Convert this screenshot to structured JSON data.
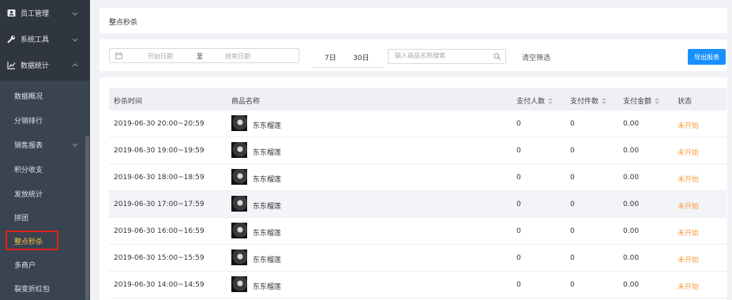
{
  "sidebar": {
    "top_items": [
      {
        "label": "员工管理",
        "icon": "id-card-icon"
      },
      {
        "label": "系统工具",
        "icon": "wrench-icon"
      },
      {
        "label": "数据统计",
        "icon": "chart-icon"
      }
    ],
    "sub_items": [
      {
        "label": "数据概况"
      },
      {
        "label": "分销排行"
      },
      {
        "label": "销售报表"
      },
      {
        "label": "积分收支"
      },
      {
        "label": "发放统计"
      },
      {
        "label": "拼团"
      },
      {
        "label": "整点秒杀"
      },
      {
        "label": "多商户"
      },
      {
        "label": "裂变折红包"
      }
    ],
    "active_label": "整点秒杀"
  },
  "header": {
    "title": "整点秒杀"
  },
  "filter": {
    "start_placeholder": "开始日期",
    "separator": "至",
    "end_placeholder": "结束日期",
    "quick_7": "7日",
    "quick_30": "30日",
    "search_placeholder": "输入商品名称搜索",
    "clear_label": "清空筛选",
    "export_label": "导出报表"
  },
  "table": {
    "columns": [
      "秒杀时间",
      "商品名称",
      "支付人数",
      "支付件数",
      "支付金额",
      "状态"
    ],
    "rows": [
      {
        "time": "2019-06-30 20:00~20:59",
        "product": "东东榴莲",
        "payers": "0",
        "items": "0",
        "amount": "0.00",
        "status": "未开始"
      },
      {
        "time": "2019-06-30 19:00~19:59",
        "product": "东东榴莲",
        "payers": "0",
        "items": "0",
        "amount": "0.00",
        "status": "未开始"
      },
      {
        "time": "2019-06-30 18:00~18:59",
        "product": "东东榴莲",
        "payers": "0",
        "items": "0",
        "amount": "0.00",
        "status": "未开始"
      },
      {
        "time": "2019-06-30 17:00~17:59",
        "product": "东东榴莲",
        "payers": "0",
        "items": "0",
        "amount": "0.00",
        "status": "未开始"
      },
      {
        "time": "2019-06-30 16:00~16:59",
        "product": "东东榴莲",
        "payers": "0",
        "items": "0",
        "amount": "0.00",
        "status": "未开始"
      },
      {
        "time": "2019-06-30 15:00~15:59",
        "product": "东东榴莲",
        "payers": "0",
        "items": "0",
        "amount": "0.00",
        "status": "未开始"
      },
      {
        "time": "2019-06-30 14:00~14:59",
        "product": "东东榴莲",
        "payers": "0",
        "items": "0",
        "amount": "0.00",
        "status": "未开始"
      }
    ]
  },
  "colors": {
    "sidebar_bg": "#2f3640",
    "submenu_bg": "#3a4350",
    "active_text": "#f5c542",
    "active_border": "#e0201a",
    "primary": "#1890ff",
    "status_pending": "#f5a044"
  }
}
